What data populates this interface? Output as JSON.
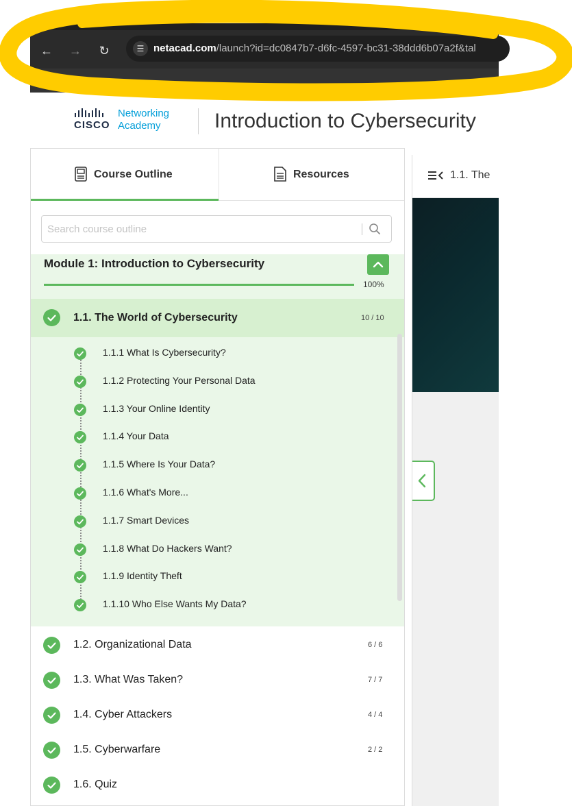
{
  "browser": {
    "url_host": "netacad.com",
    "url_path": "/launch?id=dc0847b7-d6fc-4597-bc31-38ddd6b07a2f&tal"
  },
  "header": {
    "logo_word": "CISCO",
    "logo_line1": "Networking",
    "logo_line2": "Academy",
    "course_title": "Introduction to Cybersecurity"
  },
  "sidebar": {
    "tabs": [
      {
        "label": "Course Outline",
        "selected": true
      },
      {
        "label": "Resources",
        "selected": false
      }
    ],
    "search_placeholder": "Search course outline",
    "module": {
      "title": "Module 1: Introduction to Cybersecurity",
      "progress_percent": 100,
      "progress_label": "100%"
    },
    "active_section": {
      "title": "1.1. The World of Cybersecurity",
      "count": "10 / 10",
      "topics": [
        "1.1.1 What Is Cybersecurity?",
        "1.1.2 Protecting Your Personal Data",
        "1.1.3 Your Online Identity",
        "1.1.4 Your Data",
        "1.1.5 Where Is Your Data?",
        "1.1.6 What's More...",
        "1.1.7 Smart Devices",
        "1.1.8 What Do Hackers Want?",
        "1.1.9 Identity Theft",
        "1.1.10 Who Else Wants My Data?"
      ]
    },
    "sections": [
      {
        "title": "1.2. Organizational Data",
        "count": "6 / 6"
      },
      {
        "title": "1.3. What Was Taken?",
        "count": "7 / 7"
      },
      {
        "title": "1.4. Cyber Attackers",
        "count": "4 / 4"
      },
      {
        "title": "1.5. Cyberwarfare",
        "count": "2 / 2"
      },
      {
        "title": "1.6. Quiz",
        "count": ""
      }
    ]
  },
  "content": {
    "title": "1.1. The"
  },
  "colors": {
    "accent_green": "#5cb85c",
    "module_bg": "#eaf7e8",
    "active_section_bg": "#d7f0d0",
    "cisco_blue": "#049fd9",
    "highlight_yellow": "#ffcc00"
  }
}
